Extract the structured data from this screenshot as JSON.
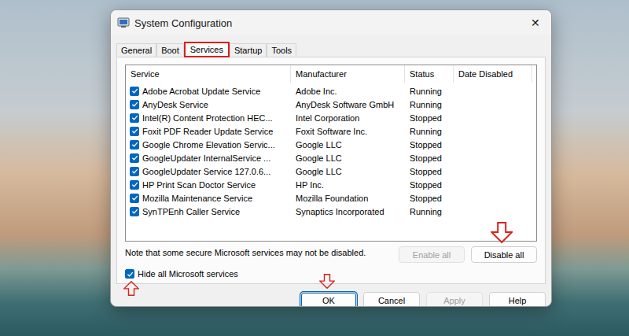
{
  "window": {
    "title": "System Configuration",
    "close": "✕"
  },
  "tabs": [
    {
      "label": "General",
      "selected": false,
      "marker": "none"
    },
    {
      "label": "Boot",
      "selected": false,
      "marker": "none"
    },
    {
      "label": "Services",
      "selected": true,
      "marker": "box"
    },
    {
      "label": "Startup",
      "selected": false,
      "marker": "none"
    },
    {
      "label": "Tools",
      "selected": false,
      "marker": "none"
    }
  ],
  "table": {
    "columns": [
      "Service",
      "Manufacturer",
      "Status",
      "Date Disabled"
    ],
    "rows": [
      {
        "service": "Adobe Acrobat Update Service",
        "manufacturer": "Adobe Inc.",
        "status": "Running",
        "date_disabled": "",
        "checked": true
      },
      {
        "service": "AnyDesk Service",
        "manufacturer": "AnyDesk Software GmbH",
        "status": "Running",
        "date_disabled": "",
        "checked": true
      },
      {
        "service": "Intel(R) Content Protection HEC...",
        "manufacturer": "Intel Corporation",
        "status": "Stopped",
        "date_disabled": "",
        "checked": true
      },
      {
        "service": "Foxit PDF Reader Update Service",
        "manufacturer": "Foxit Software Inc.",
        "status": "Running",
        "date_disabled": "",
        "checked": true
      },
      {
        "service": "Google Chrome Elevation Servic...",
        "manufacturer": "Google LLC",
        "status": "Stopped",
        "date_disabled": "",
        "checked": true
      },
      {
        "service": "GoogleUpdater InternalService ...",
        "manufacturer": "Google LLC",
        "status": "Stopped",
        "date_disabled": "",
        "checked": true
      },
      {
        "service": "GoogleUpdater Service 127.0.6...",
        "manufacturer": "Google LLC",
        "status": "Stopped",
        "date_disabled": "",
        "checked": true
      },
      {
        "service": "HP Print Scan Doctor Service",
        "manufacturer": "HP Inc.",
        "status": "Stopped",
        "date_disabled": "",
        "checked": true
      },
      {
        "service": "Mozilla Maintenance Service",
        "manufacturer": "Mozilla Foundation",
        "status": "Stopped",
        "date_disabled": "",
        "checked": true
      },
      {
        "service": "SynTPEnh Caller Service",
        "manufacturer": "Synaptics Incorporated",
        "status": "Running",
        "date_disabled": "",
        "checked": true
      }
    ]
  },
  "note": "Note that some secure Microsoft services may not be disabled.",
  "list_buttons": [
    {
      "label": "Enable all",
      "disabled": true,
      "marker": "none"
    },
    {
      "label": "Disable all",
      "disabled": false,
      "marker": "arrow-down"
    }
  ],
  "hide_microsoft": {
    "label": "Hide all Microsoft services",
    "checked": true,
    "marker": "arrow-up"
  },
  "buttons": [
    {
      "label": "OK",
      "disabled": false,
      "focused": true,
      "marker": "arrow-down"
    },
    {
      "label": "Cancel",
      "disabled": false,
      "focused": false,
      "marker": "none"
    },
    {
      "label": "Apply",
      "disabled": true,
      "focused": false,
      "marker": "none"
    },
    {
      "label": "Help",
      "disabled": false,
      "focused": false,
      "marker": "none"
    }
  ]
}
